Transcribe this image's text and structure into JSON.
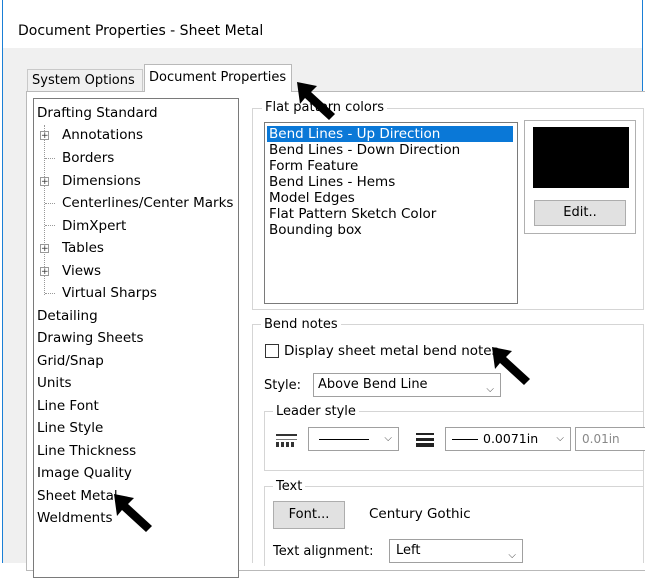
{
  "window": {
    "title": "Document Properties - Sheet Metal"
  },
  "tabs": [
    {
      "label": "System Options",
      "active": false
    },
    {
      "label": "Document Properties",
      "active": true
    }
  ],
  "tree": {
    "items": [
      {
        "label": "Drafting Standard"
      },
      {
        "label": "Annotations"
      },
      {
        "label": "Borders"
      },
      {
        "label": "Dimensions"
      },
      {
        "label": "Centerlines/Center Marks"
      },
      {
        "label": "DimXpert"
      },
      {
        "label": "Tables"
      },
      {
        "label": "Views"
      },
      {
        "label": "Virtual Sharps"
      },
      {
        "label": "Detailing"
      },
      {
        "label": "Drawing Sheets"
      },
      {
        "label": "Grid/Snap"
      },
      {
        "label": "Units"
      },
      {
        "label": "Line Font"
      },
      {
        "label": "Line Style"
      },
      {
        "label": "Line Thickness"
      },
      {
        "label": "Image Quality"
      },
      {
        "label": "Sheet Metal"
      },
      {
        "label": "Weldments"
      }
    ]
  },
  "flat_pattern": {
    "title": "Flat pattern colors",
    "items": [
      {
        "label": "Bend Lines - Up Direction"
      },
      {
        "label": "Bend Lines - Down Direction"
      },
      {
        "label": "Form Feature"
      },
      {
        "label": "Bend Lines - Hems"
      },
      {
        "label": "Model Edges"
      },
      {
        "label": "Flat Pattern Sketch Color"
      },
      {
        "label": "Bounding box"
      }
    ],
    "selected_index": 0,
    "swatch_color": "#000000",
    "edit_label": "Edit.."
  },
  "bend_notes": {
    "title": "Bend notes",
    "display_checkbox_label": "Display sheet metal bend notes",
    "style_label": "Style:",
    "style_value": "Above Bend Line",
    "leader_style": {
      "title": "Leader style",
      "thickness_value": "0.0071in",
      "custom_value": "0.01in"
    },
    "text": {
      "title": "Text",
      "font_button": "Font...",
      "font_name": "Century Gothic",
      "alignment_label": "Text alignment:",
      "alignment_value": "Left"
    }
  },
  "colors": {
    "accent": "#0a78d7",
    "window_border": "#1a7fd6"
  }
}
